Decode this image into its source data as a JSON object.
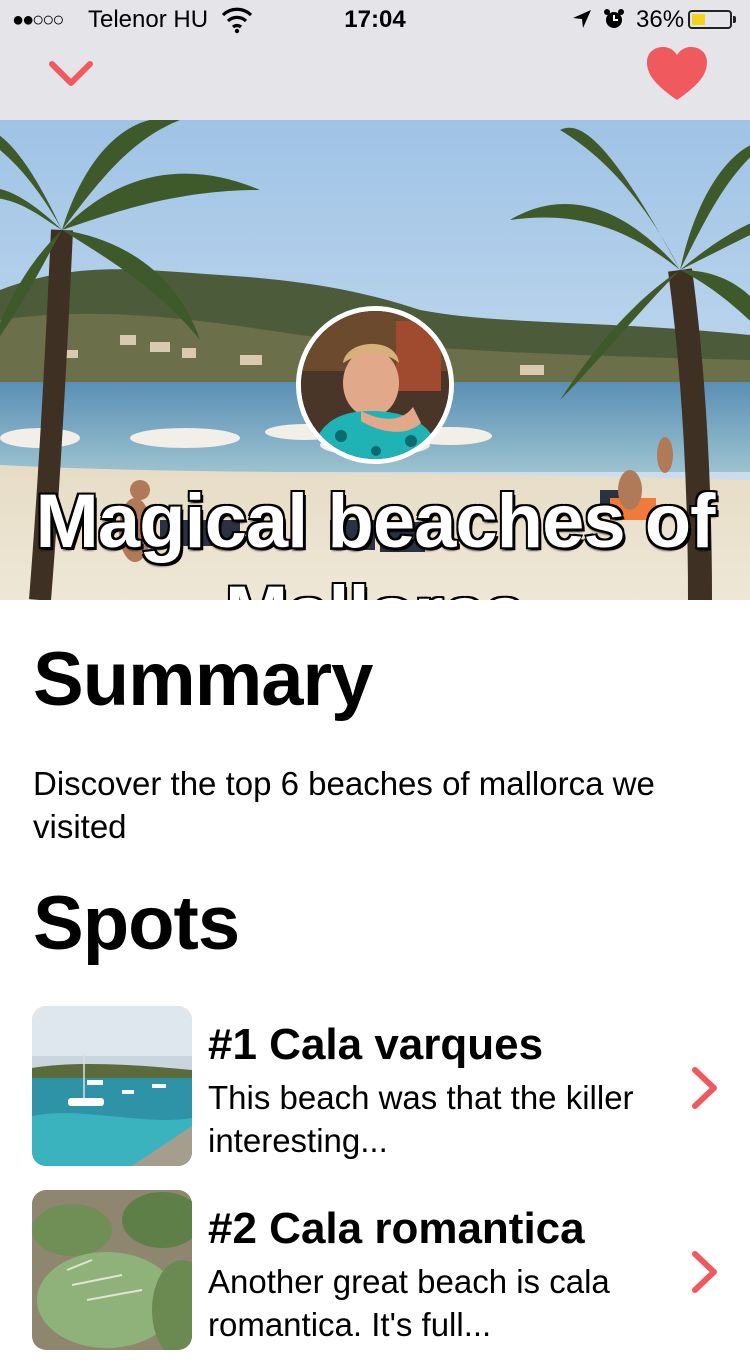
{
  "status_bar": {
    "signal": "●●○○○",
    "carrier": "Telenor HU",
    "time": "17:04",
    "battery_percent": "36%",
    "battery_level": 0.36,
    "icons": [
      "wifi-icon",
      "location-arrow-icon",
      "alarm-clock-icon",
      "battery-icon"
    ]
  },
  "nav": {
    "back_icon": "chevron-down-icon",
    "favorite_icon": "heart-icon",
    "accent_color": "#f05a5f"
  },
  "hero": {
    "title": "Magical beaches of Mallorca",
    "image": "beach-with-palm-trees-photo",
    "avatar": "author-avatar-photo"
  },
  "summary": {
    "heading": "Summary",
    "text": "Discover the top 6 beaches of mallorca we visited"
  },
  "spots": {
    "heading": "Spots",
    "items": [
      {
        "title": "#1 Cala varques",
        "description": "This beach was that the killer interesting...",
        "thumbnail": "boats-in-bay-photo"
      },
      {
        "title": "#2 Cala romantica",
        "description": "Another great beach is cala romantica. It's full...",
        "thumbnail": "cactus-leaf-photo"
      }
    ]
  }
}
